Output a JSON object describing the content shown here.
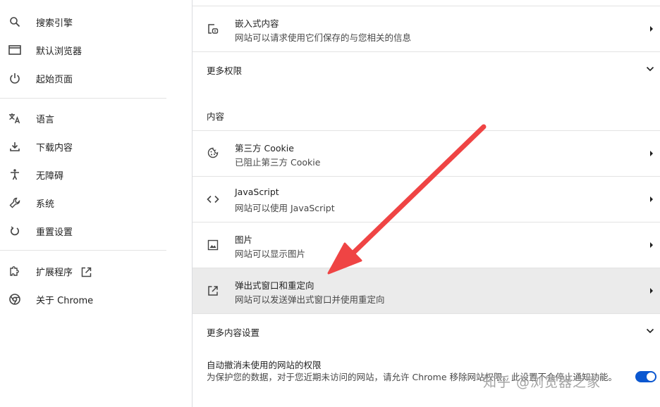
{
  "sidebar": {
    "items": [
      {
        "label": "搜索引擎",
        "icon": "search-icon"
      },
      {
        "label": "默认浏览器",
        "icon": "browser-window-icon"
      },
      {
        "label": "起始页面",
        "icon": "power-icon"
      },
      {
        "label": "语言",
        "icon": "translate-icon"
      },
      {
        "label": "下载内容",
        "icon": "download-icon"
      },
      {
        "label": "无障碍",
        "icon": "accessibility-icon"
      },
      {
        "label": "系统",
        "icon": "wrench-icon"
      },
      {
        "label": "重置设置",
        "icon": "reset-icon"
      },
      {
        "label": "扩展程序",
        "icon": "puzzle-icon"
      },
      {
        "label": "关于 Chrome",
        "icon": "chrome-logo-icon"
      }
    ]
  },
  "main": {
    "embedded": {
      "title": "嵌入式内容",
      "subtitle": "网站可以请求使用它们保存的与您相关的信息"
    },
    "more_permissions": "更多权限",
    "content_heading": "内容",
    "rows": [
      {
        "title": "第三方 Cookie",
        "subtitle": "已阻止第三方 Cookie",
        "icon": "cookie-icon"
      },
      {
        "title": "JavaScript",
        "subtitle": "网站可以使用 JavaScript",
        "icon": "code-icon"
      },
      {
        "title": "图片",
        "subtitle": "网站可以显示图片",
        "icon": "image-icon"
      },
      {
        "title": "弹出式窗口和重定向",
        "subtitle": "网站可以发送弹出式窗口并使用重定向",
        "icon": "open-external-icon"
      }
    ],
    "more_content_settings": "更多内容设置",
    "auto_revoke": {
      "title": "自动撤消未使用的网站的权限",
      "description": "为保护您的数据，对于您近期未访问的网站，请允许 Chrome 移除网站权限。此设置不会停止通知功能。",
      "toggle_on": true
    }
  },
  "watermark": "知乎 @浏览器之家",
  "colors": {
    "accent": "#0b57d0",
    "highlight_row": "#ebebeb",
    "annotation_arrow": "#ef4444"
  }
}
